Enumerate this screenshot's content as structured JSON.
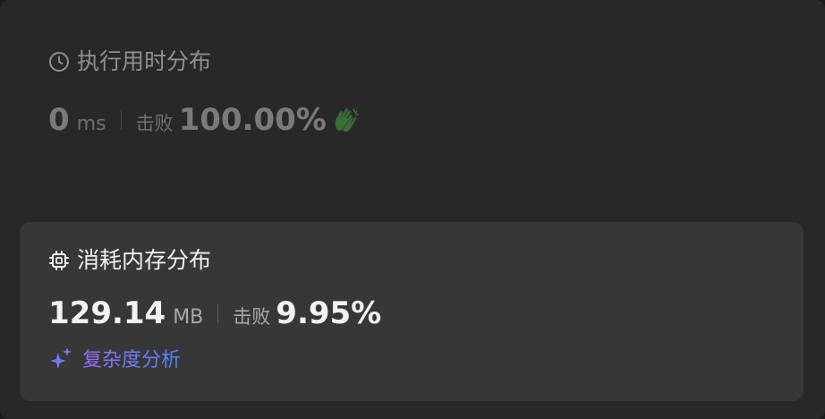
{
  "runtime": {
    "title": "执行用时分布",
    "value": "0",
    "unit": "ms",
    "beat_label": "击败",
    "beat_percent": "100.00%",
    "icon": "clock-icon",
    "badge_icon": "clapping-hands-icon"
  },
  "memory": {
    "title": "消耗内存分布",
    "value": "129.14",
    "unit": "MB",
    "beat_label": "击败",
    "beat_percent": "9.95%",
    "icon": "chip-icon"
  },
  "analysis": {
    "label": "复杂度分析",
    "icon": "sparkle-icon"
  },
  "colors": {
    "background": "#282828",
    "card": "#373737",
    "accent_gradient_start": "#9b6cf3",
    "accent_gradient_end": "#4f86f5",
    "clap_green": "#3d6e3a"
  }
}
